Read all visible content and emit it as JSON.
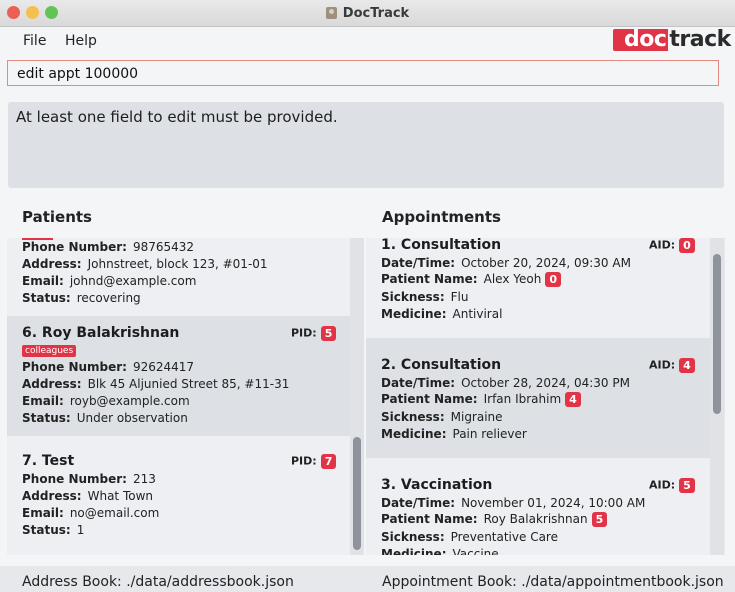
{
  "window": {
    "title": "DocTrack"
  },
  "menu": {
    "file": "File",
    "help": "Help"
  },
  "logo": {
    "part1": "doc",
    "part2": "track"
  },
  "command": {
    "value": "edit appt 100000"
  },
  "result": {
    "message": "At least one field to edit must be provided."
  },
  "patients": {
    "title": "Patients",
    "labels": {
      "phone": "Phone Number:",
      "address": "Address:",
      "email": "Email:",
      "status": "Status:",
      "pid": "PID:"
    },
    "items": [
      {
        "phone": "98765432",
        "address": "Johnstreet, block 123, #01-01",
        "email": "johnd@example.com",
        "status": "recovering"
      },
      {
        "name": "6. Roy Balakrishnan",
        "pid": "5",
        "tag": "colleagues",
        "phone": "92624417",
        "address": "Blk 45 Aljunied Street 85, #11-31",
        "email": "royb@example.com",
        "status": "Under observation"
      },
      {
        "name": "7. Test",
        "pid": "7",
        "phone": "213",
        "address": "What Town",
        "email": "no@email.com",
        "status": "1"
      }
    ]
  },
  "appointments": {
    "title": "Appointments",
    "labels": {
      "datetime": "Date/Time:",
      "patient": "Patient Name:",
      "sickness": "Sickness:",
      "medicine": "Medicine:",
      "aid": "AID:"
    },
    "items": [
      {
        "name": "1. Consultation",
        "aid": "0",
        "datetime": "October 20, 2024, 09:30 AM",
        "patient": "Alex Yeoh",
        "pid": "0",
        "sickness": "Flu",
        "medicine": "Antiviral"
      },
      {
        "name": "2. Consultation",
        "aid": "4",
        "datetime": "October 28, 2024, 04:30 PM",
        "patient": "Irfan Ibrahim",
        "pid": "4",
        "sickness": "Migraine",
        "medicine": "Pain reliever"
      },
      {
        "name": "3. Vaccination",
        "aid": "5",
        "datetime": "November 01, 2024, 10:00 AM",
        "patient": "Roy Balakrishnan",
        "pid": "5",
        "sickness": "Preventative Care",
        "medicine": "Vaccine"
      }
    ]
  },
  "status": {
    "address_book": "Address Book: ./data/addressbook.json",
    "appointment_book": "Appointment Book: ./data/appointmentbook.json"
  },
  "colors": {
    "accent": "#e23447",
    "panel": "#e6e8ec"
  }
}
